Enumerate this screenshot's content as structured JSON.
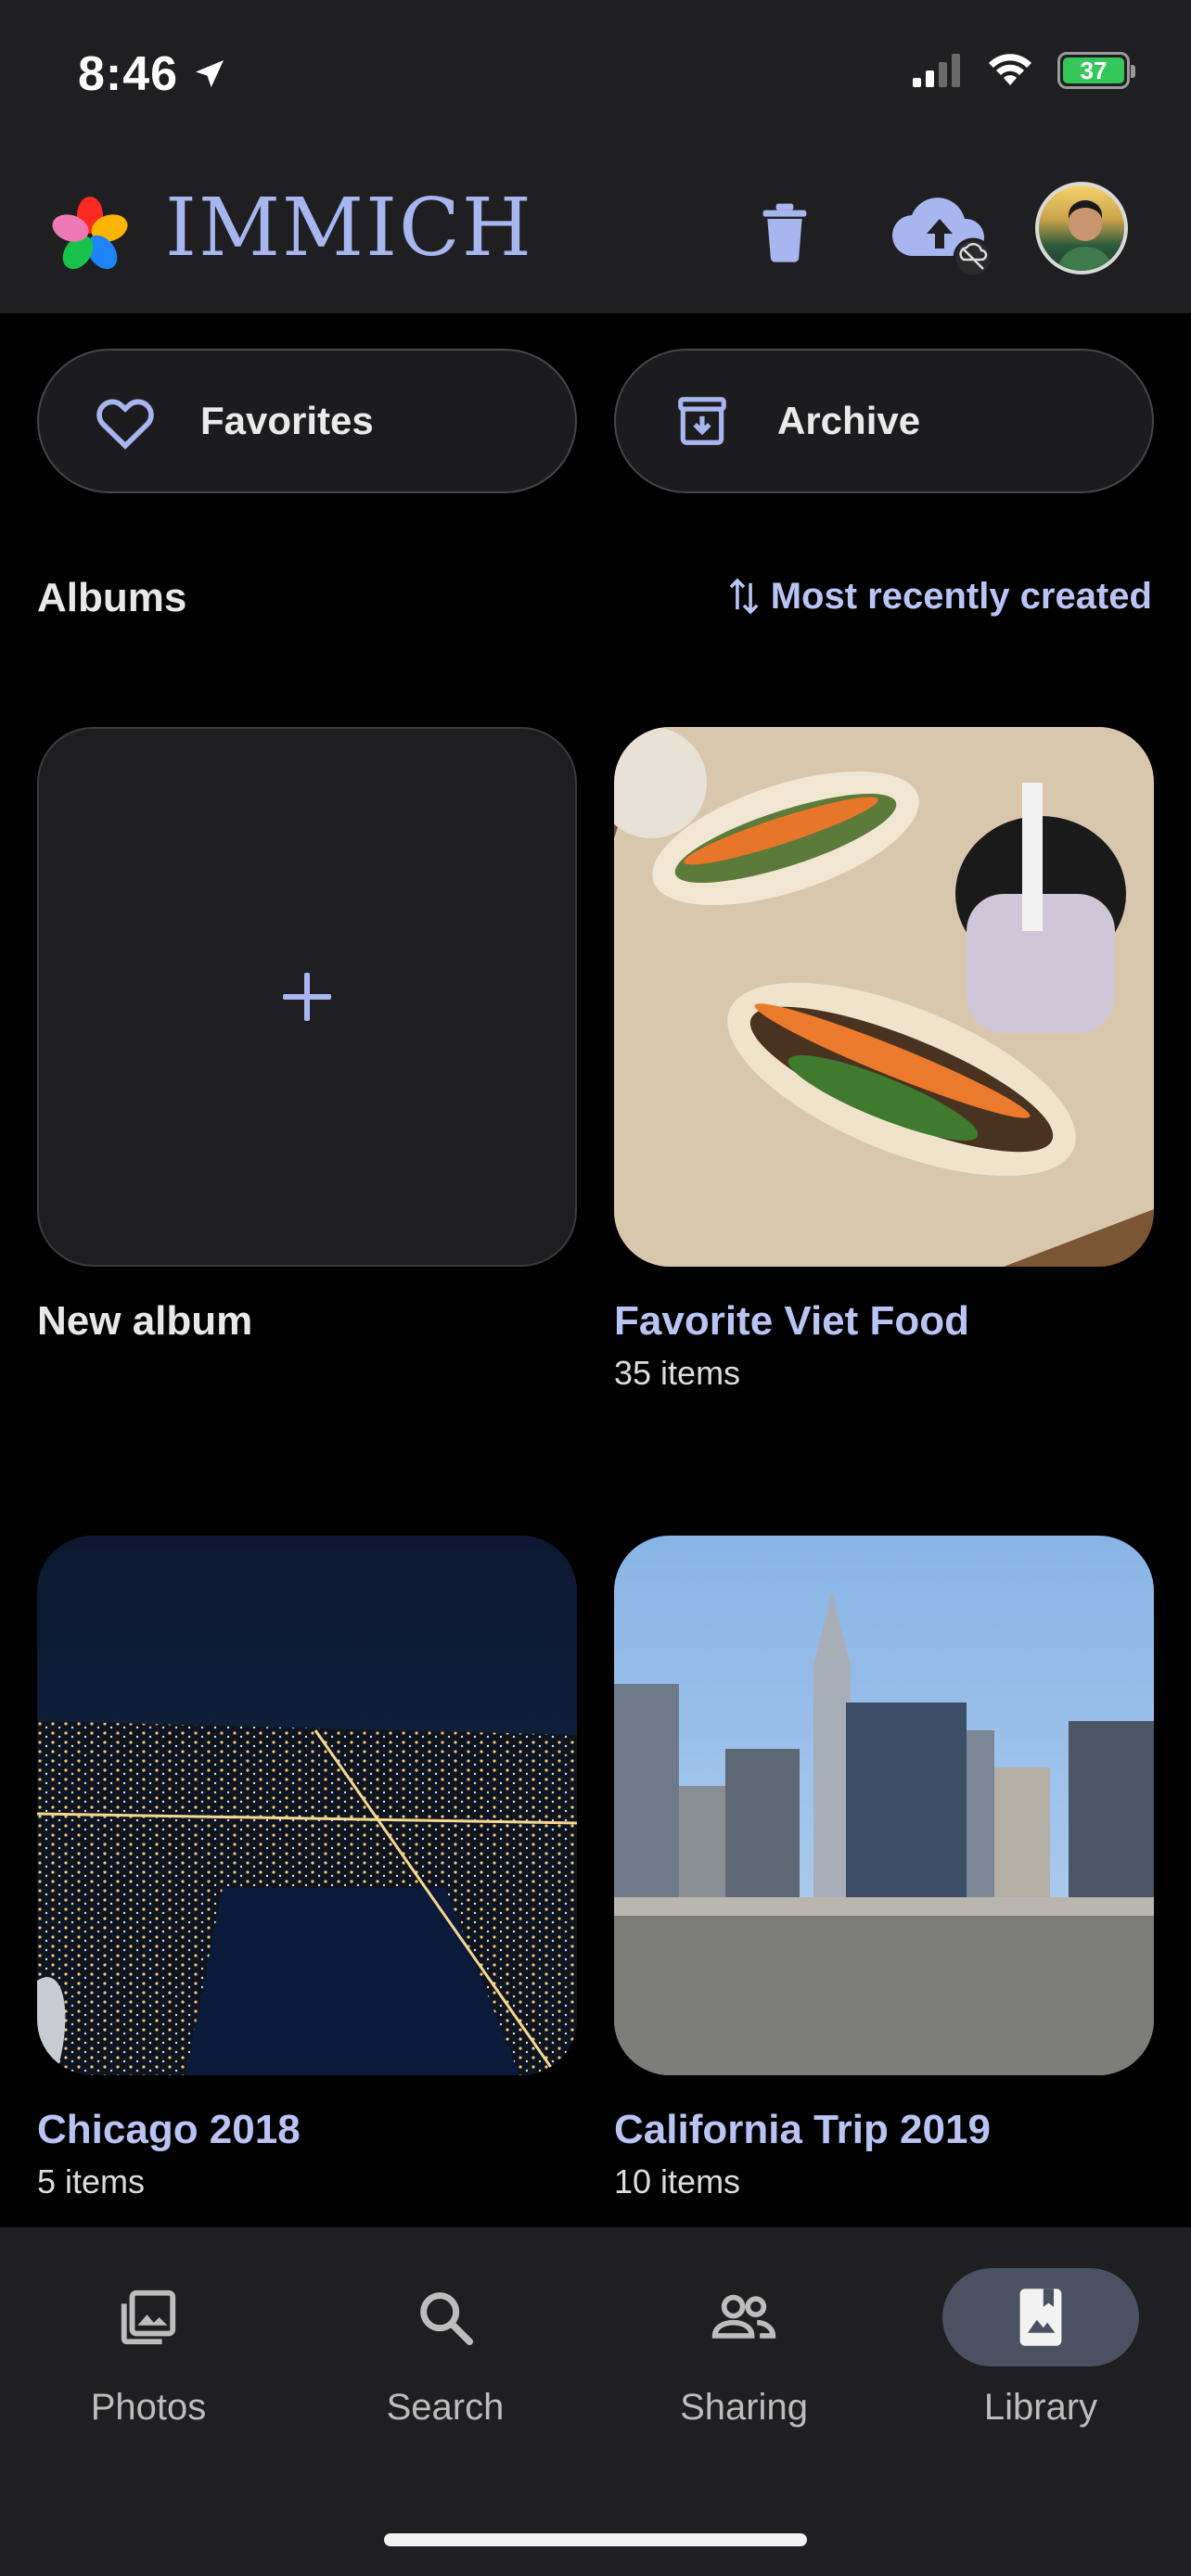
{
  "status": {
    "time": "8:46",
    "battery": "37"
  },
  "header": {
    "brand": "IMMICH"
  },
  "quick": {
    "favorites": "Favorites",
    "archive": "Archive"
  },
  "albums": {
    "title": "Albums",
    "sort_label": "Most recently created",
    "new_album": "New album",
    "items": [
      {
        "name": "Favorite Viet Food",
        "count": "35 items"
      },
      {
        "name": "Chicago 2018",
        "count": "5 items"
      },
      {
        "name": "California Trip 2019",
        "count": "10 items"
      }
    ]
  },
  "nav": {
    "items": [
      {
        "label": "Photos",
        "icon": "photos-icon"
      },
      {
        "label": "Search",
        "icon": "search-icon"
      },
      {
        "label": "Sharing",
        "icon": "people-icon"
      },
      {
        "label": "Library",
        "icon": "library-icon"
      }
    ],
    "active": "Library"
  },
  "colors": {
    "accent": "#b9c4f5",
    "surface": "#1f1f21",
    "background": "#000000",
    "active_nav": "#4b5160"
  }
}
